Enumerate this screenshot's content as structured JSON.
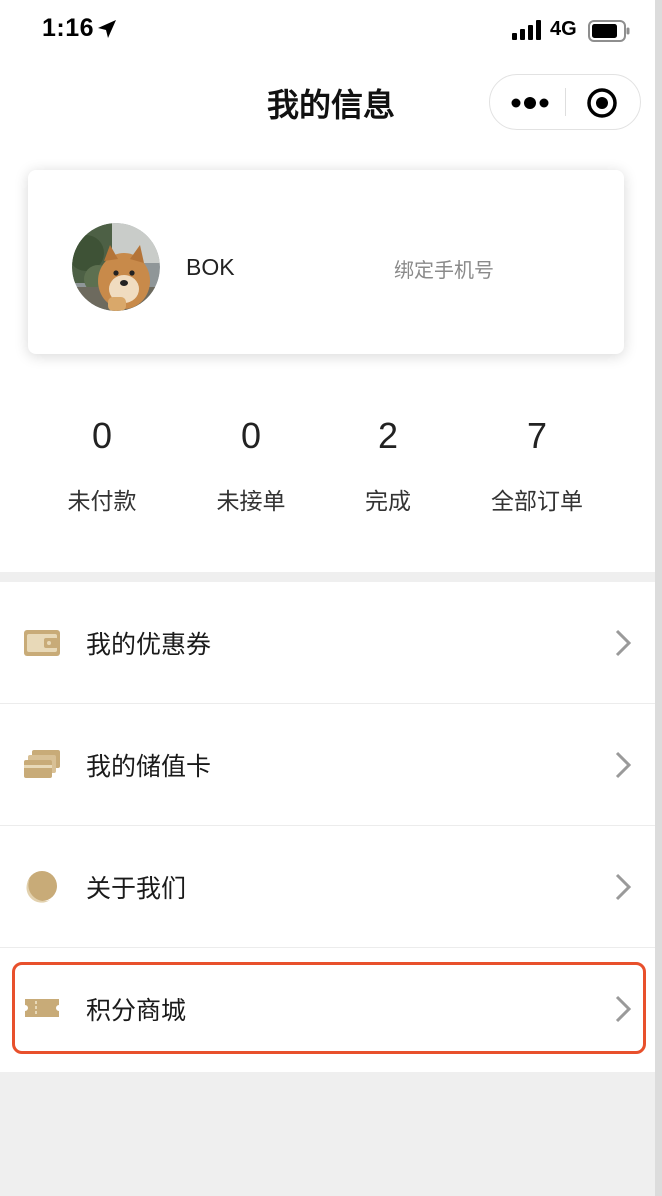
{
  "status_bar": {
    "time": "1:16",
    "network": "4G"
  },
  "header": {
    "title": "我的信息"
  },
  "profile": {
    "username": "BOK",
    "bind_phone_label": "绑定手机号"
  },
  "order_stats": [
    {
      "count": "0",
      "label": "未付款"
    },
    {
      "count": "0",
      "label": "未接单"
    },
    {
      "count": "2",
      "label": "完成"
    },
    {
      "count": "7",
      "label": "全部订单"
    }
  ],
  "menu": {
    "items": [
      {
        "label": "我的优惠券",
        "icon": "wallet-icon"
      },
      {
        "label": "我的储值卡",
        "icon": "cards-icon"
      },
      {
        "label": "关于我们",
        "icon": "moon-icon"
      },
      {
        "label": "积分商城",
        "icon": "ticket-icon"
      }
    ]
  },
  "colors": {
    "icon_gold": "#c8ab78",
    "highlight": "#e8502c",
    "page_bg": "#efefef"
  }
}
